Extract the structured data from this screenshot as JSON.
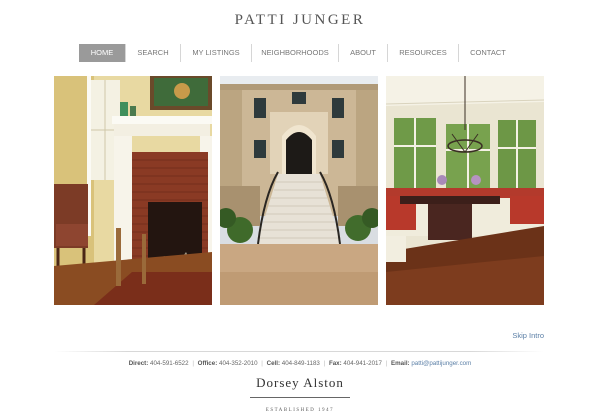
{
  "site": {
    "title": "PATTI JUNGER"
  },
  "nav": {
    "items": [
      {
        "label": "HOME",
        "active": true
      },
      {
        "label": "SEARCH",
        "active": false
      },
      {
        "label": "MY LISTINGS",
        "active": false
      },
      {
        "label": "NEIGHBORHOODS",
        "active": false
      },
      {
        "label": "ABOUT",
        "active": false
      },
      {
        "label": "RESOURCES",
        "active": false
      },
      {
        "label": "CONTACT",
        "active": false
      }
    ]
  },
  "gallery": {
    "photos": [
      "fireplace-interior-photo",
      "stone-villa-exterior-photo",
      "breakfast-nook-photo"
    ]
  },
  "skip_intro": "Skip Intro",
  "contact": {
    "direct_label": "Direct:",
    "direct": "404-591-6522",
    "office_label": "Office:",
    "office": "404-352-2010",
    "cell_label": "Cell:",
    "cell": "404-849-1183",
    "fax_label": "Fax:",
    "fax": "404-941-2017",
    "email_label": "Email:",
    "email": "patti@pattijunger.com"
  },
  "brokerage": {
    "name": "Dorsey Alston",
    "tagline": "ESTABLISHED 1947"
  },
  "colors": {
    "nav_active": "#9a9a9a",
    "link": "#5b7fa6"
  }
}
